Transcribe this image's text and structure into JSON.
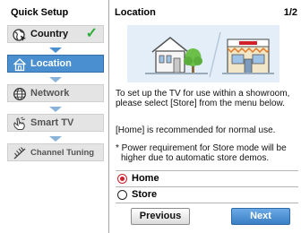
{
  "sidebar": {
    "title": "Quick Setup",
    "steps": [
      {
        "label": "Country",
        "icon": "globe-pointer-icon",
        "state": "done",
        "check": "✓"
      },
      {
        "label": "Location",
        "icon": "house-icon",
        "state": "active"
      },
      {
        "label": "Network",
        "icon": "globe-network-icon",
        "state": "pending"
      },
      {
        "label": "Smart TV",
        "icon": "hand-touch-icon",
        "state": "pending"
      },
      {
        "label": "Channel Tuning",
        "icon": "antenna-icon",
        "state": "pending"
      }
    ]
  },
  "main": {
    "title": "Location",
    "page_indicator": "1/2",
    "illustration": {
      "left": "home-with-tree-icon",
      "right": "store-building-icon"
    },
    "paragraph1": "To set up the TV for use within a showroom, please select [Store] from the menu below.",
    "paragraph2": "[Home] is recommended for normal use.",
    "note": "* Power requirement for Store mode will be higher due to automatic store demos.",
    "options": [
      {
        "label": "Home",
        "selected": true
      },
      {
        "label": "Store",
        "selected": false
      }
    ],
    "buttons": {
      "previous": "Previous",
      "next": "Next"
    }
  },
  "colors": {
    "accent_blue": "#4a8fd0",
    "check_green": "#2fae3a",
    "radio_red": "#d0202a"
  }
}
